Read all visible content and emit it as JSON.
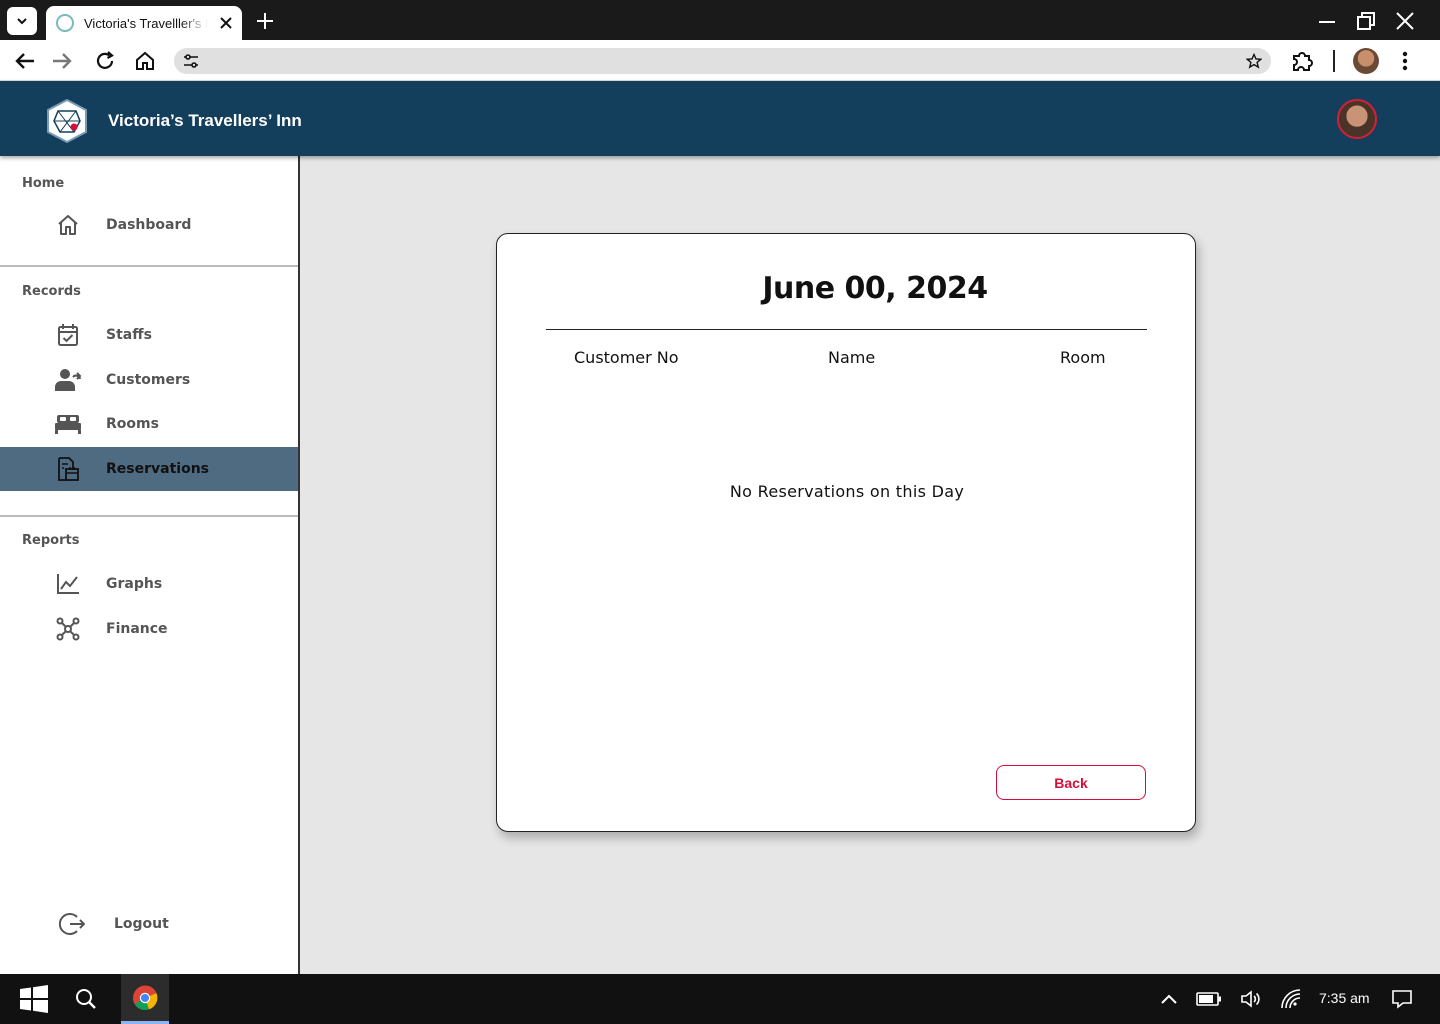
{
  "browser": {
    "tab_title": "Victoria's Travelller's Inn",
    "icons": [
      "tab-search-icon",
      "favicon",
      "close-icon",
      "plus-icon",
      "minimize-icon",
      "restore-icon",
      "window-close-icon",
      "back-arrow-icon",
      "forward-arrow-icon",
      "reload-icon",
      "home-icon",
      "tune-icon",
      "star-icon",
      "extensions-icon",
      "profile-avatar",
      "kebab-menu-icon"
    ]
  },
  "header": {
    "brand": "Victoria’s Travellers’ Inn"
  },
  "sidebar": {
    "sections": {
      "home": "Home",
      "records": "Records",
      "reports": "Reports"
    },
    "items": {
      "dashboard": "Dashboard",
      "staffs": "Staffs",
      "customers": "Customers",
      "rooms": "Rooms",
      "reservations": "Reservations",
      "graphs": "Graphs",
      "finance": "Finance",
      "logout": "Logout"
    },
    "active_item": "reservations"
  },
  "card": {
    "date": "June 00, 2024",
    "columns": [
      "Customer No",
      "Name",
      "Room"
    ],
    "empty_message": "No Reservations on this Day",
    "back_label": "Back"
  },
  "taskbar": {
    "time": "7:35 am"
  },
  "colors": {
    "header_bg": "#133f5c",
    "active_nav_bg": "#4e6b82",
    "accent_red": "#d0103a",
    "content_bg": "#e6e6e6"
  }
}
